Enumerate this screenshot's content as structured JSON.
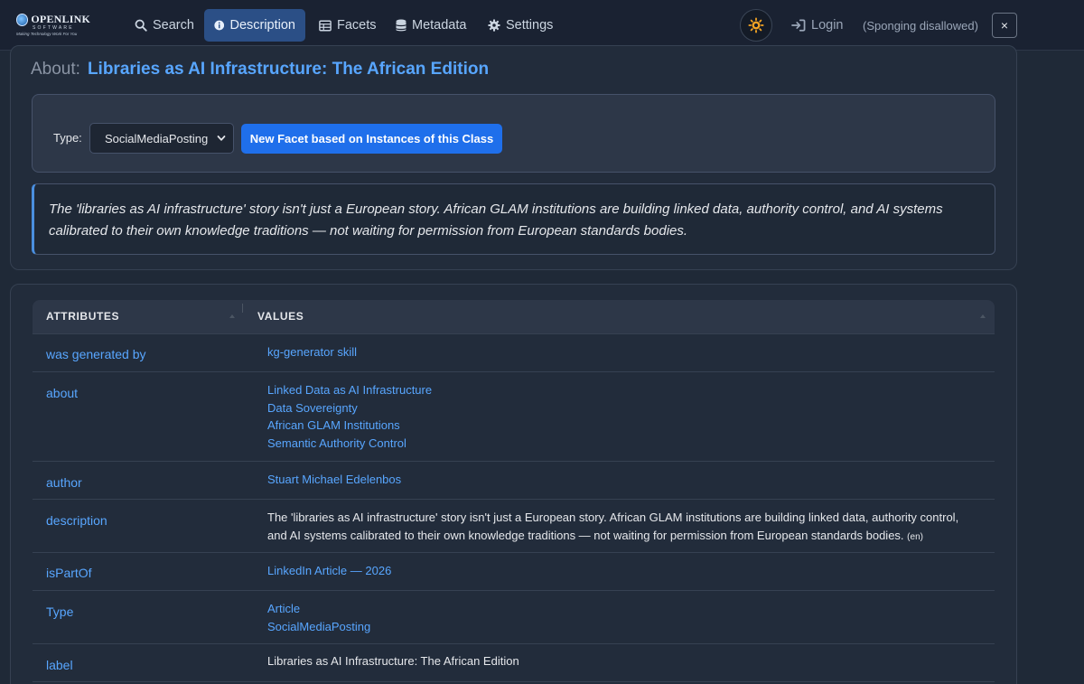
{
  "brand": {
    "name": "OPENLINK",
    "sub": "SOFTWARE",
    "tagline": "Making Technology Work For You"
  },
  "nav": {
    "search": "Search",
    "description": "Description",
    "facets": "Facets",
    "metadata": "Metadata",
    "settings": "Settings",
    "login": "Login",
    "sponging": "(Sponging disallowed)",
    "close": "×"
  },
  "header": {
    "about_label": "About:",
    "title": "Libraries as AI Infrastructure: The African Edition"
  },
  "type_panel": {
    "label": "Type:",
    "selected": "SocialMediaPosting",
    "button": "New Facet based on Instances of this Class"
  },
  "summary": "The 'libraries as AI infrastructure' story isn't just a European story. African GLAM institutions are building linked data, authority control, and AI systems calibrated to their own knowledge traditions — not waiting for permission from European standards bodies.",
  "table": {
    "col_attributes": "ATTRIBUTES",
    "col_values": "VALUES",
    "rows": [
      {
        "attr": "was generated by",
        "values": [
          "kg-generator skill"
        ]
      },
      {
        "attr": "about",
        "values": [
          "Linked Data as AI Infrastructure",
          "Data Sovereignty",
          "African GLAM Institutions",
          "Semantic Authority Control"
        ]
      },
      {
        "attr": "author",
        "values": [
          "Stuart Michael Edelenbos"
        ]
      },
      {
        "attr": "description",
        "text_line1": "The 'libraries as AI infrastructure' story isn't just a European story. African GLAM institutions are building linked data, authority control,",
        "text_line2": "and AI systems calibrated to their own knowledge traditions — not waiting for permission from European standards bodies.",
        "lang": "(en)"
      },
      {
        "attr": "isPartOf",
        "values": [
          "LinkedIn Article — 2026"
        ]
      },
      {
        "attr": "Type",
        "values": [
          "Article",
          "SocialMediaPosting"
        ]
      },
      {
        "attr": "label",
        "text": "Libraries as AI Infrastructure: The African Edition"
      }
    ]
  },
  "colors": {
    "background": "#1f2937",
    "navbar": "#1a2232",
    "accent_link": "#58a6ff",
    "primary_button": "#1f6feb",
    "active_tab": "#2b4f86",
    "sun_icon": "#f5a524"
  },
  "icons": [
    "search-icon",
    "info-circle-icon",
    "table-icon",
    "database-icon",
    "gear-icon",
    "sun-icon",
    "sign-in-icon",
    "close-icon",
    "chevron-down-icon"
  ]
}
